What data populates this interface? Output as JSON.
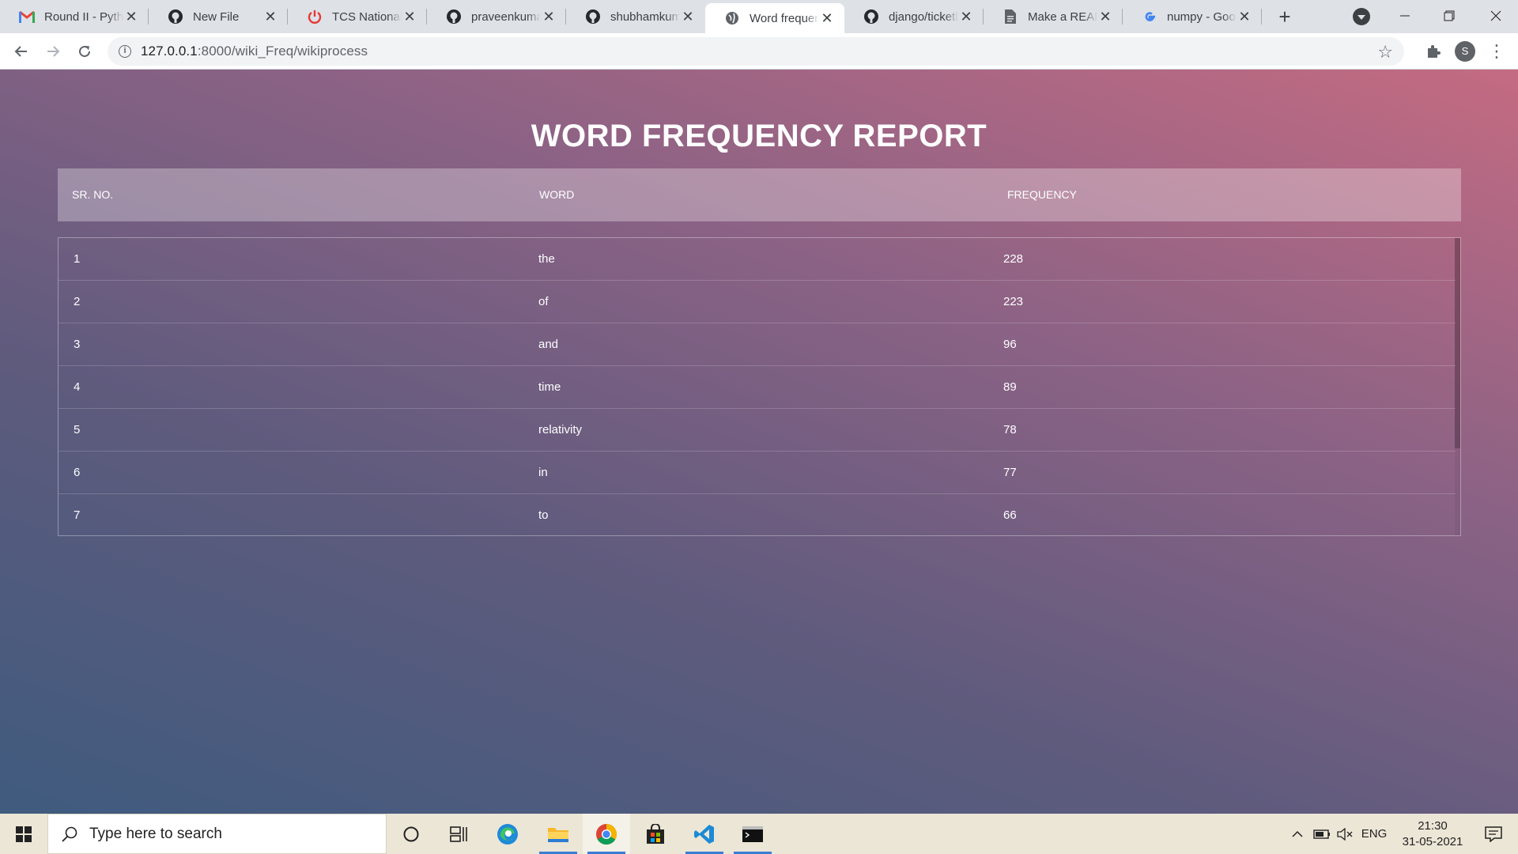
{
  "browser": {
    "tabs": [
      {
        "title": "Round II - Python",
        "icon": "gmail-icon"
      },
      {
        "title": "New File",
        "icon": "github-icon"
      },
      {
        "title": "TCS National Qualifier",
        "icon": "power-icon"
      },
      {
        "title": "praveenkumar",
        "icon": "github-icon"
      },
      {
        "title": "shubhamkumar",
        "icon": "github-icon"
      },
      {
        "title": "Word frequency",
        "icon": "globe-icon"
      },
      {
        "title": "django/ticketbooking",
        "icon": "github-icon"
      },
      {
        "title": "Make a README",
        "icon": "document-icon"
      },
      {
        "title": "numpy - Google",
        "icon": "google-icon"
      }
    ],
    "close_glyph": "✕",
    "new_tab_glyph": "+",
    "url_host": "127.0.0.1",
    "url_path": ":8000/wiki_Freq/wikiprocess",
    "profile_initial": "S"
  },
  "page": {
    "title": "WORD FREQUENCY REPORT",
    "headers": {
      "sr": "SR. NO.",
      "word": "WORD",
      "freq": "FREQUENCY"
    },
    "rows": [
      {
        "sr": "1",
        "word": "the",
        "freq": "228"
      },
      {
        "sr": "2",
        "word": "of",
        "freq": "223"
      },
      {
        "sr": "3",
        "word": "and",
        "freq": "96"
      },
      {
        "sr": "4",
        "word": "time",
        "freq": "89"
      },
      {
        "sr": "5",
        "word": "relativity",
        "freq": "78"
      },
      {
        "sr": "6",
        "word": "in",
        "freq": "77"
      },
      {
        "sr": "7",
        "word": "to",
        "freq": "66"
      }
    ]
  },
  "taskbar": {
    "search_placeholder": "Type here to search",
    "language": "ENG",
    "time": "21:30",
    "date": "31-05-2021"
  }
}
